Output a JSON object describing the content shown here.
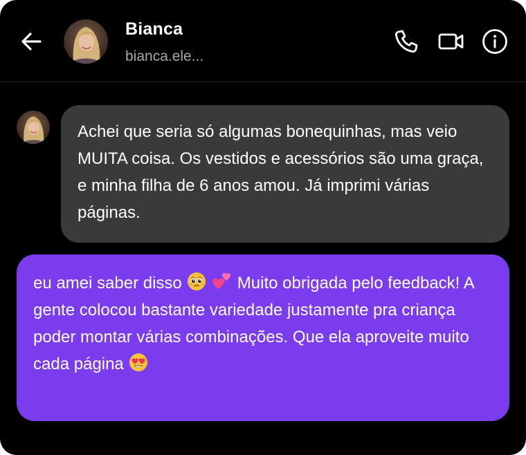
{
  "header": {
    "contact_name": "Bianca",
    "contact_handle": "bianca.ele..."
  },
  "icons": {
    "back": "arrow-left-icon",
    "call": "phone-icon",
    "video": "video-camera-icon",
    "info": "info-circle-icon"
  },
  "colors": {
    "background": "#000000",
    "incoming_bubble": "#3a3a3a",
    "outgoing_bubble": "#7a3cec",
    "handle_text": "#a8a8a8"
  },
  "messages": [
    {
      "direction": "incoming",
      "text": "Achei que seria só algumas bonequinhas, mas veio MUITA coisa. Os vestidos e acessórios são uma graça, e minha filha de 6 anos amou. Já imprimi várias páginas."
    },
    {
      "direction": "outgoing",
      "text_part1": "eu amei saber disso",
      "emoji_1": "pleading-face-emoji",
      "emoji_2": "two-hearts-emoji",
      "text_part2": "Muito obrigada pelo feedback! A gente colocou bastante variedade justamente pra criança poder montar várias combinações. Que ela aproveite muito cada página",
      "emoji_3": "heart-eyes-emoji"
    }
  ]
}
